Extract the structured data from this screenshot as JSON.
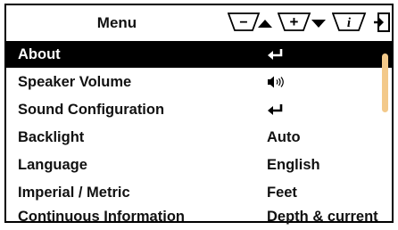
{
  "header": {
    "title": "Menu",
    "buttons": [
      {
        "name": "minus-up",
        "symbol": "−",
        "arrow": "up"
      },
      {
        "name": "plus-down",
        "symbol": "+",
        "arrow": "down"
      },
      {
        "name": "info",
        "symbol": "i"
      }
    ]
  },
  "menu": {
    "items": [
      {
        "label": "About",
        "value_icon": "enter-icon",
        "selected": true
      },
      {
        "label": "Speaker Volume",
        "value_icon": "speaker-volume-icon"
      },
      {
        "label": "Sound Configuration",
        "value_icon": "enter-icon"
      },
      {
        "label": "Backlight",
        "value": "Auto"
      },
      {
        "label": "Language",
        "value": "English"
      },
      {
        "label": "Imperial / Metric",
        "value": "Feet"
      },
      {
        "label": "Continuous Information",
        "value": "Depth & current"
      }
    ]
  },
  "scrollbar": {
    "thumb_color": "#f3c98a"
  }
}
